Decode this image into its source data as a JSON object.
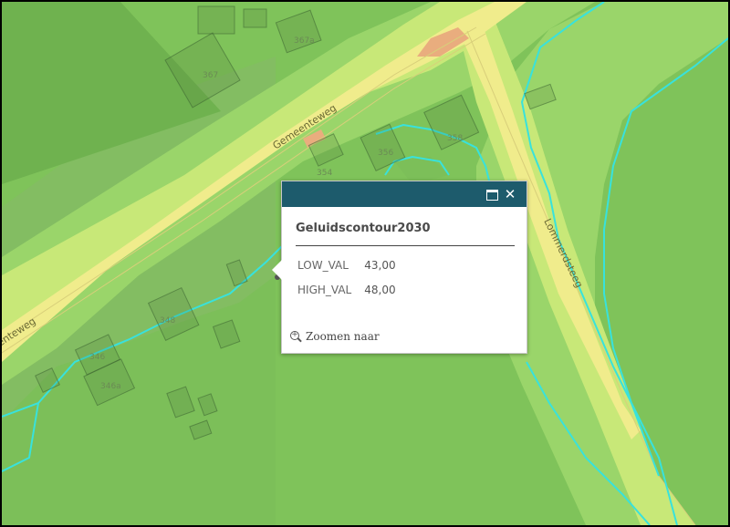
{
  "map": {
    "streets": {
      "gemeenteweg": "Gemeenteweg",
      "gemeenteweg_left": "enteweg",
      "lommerdsteeg": "Lommerdsteeg"
    },
    "house_numbers": {
      "n367a": "367a",
      "n367": "367",
      "n356": "356",
      "n358": "358",
      "n354": "354",
      "n348": "348",
      "n346": "346",
      "n346a": "346a"
    },
    "colors": {
      "low_noise": "#7fc35a",
      "mid_noise": "#a3da6b",
      "high_noise": "#d3ec7a",
      "road_noise": "#f0ec8c",
      "contour_line": "#38e2dc",
      "hot_spot": "#e9ad7e"
    }
  },
  "popup": {
    "title": "Geluidscontour2030",
    "attributes": [
      {
        "key": "LOW_VAL",
        "value": "43,00"
      },
      {
        "key": "HIGH_VAL",
        "value": "48,00"
      }
    ],
    "zoom_label": "Zoomen naar",
    "header_color": "#1d5b6c",
    "maximize_icon": "maximize-icon",
    "close_icon": "close-icon",
    "close_glyph": "✕"
  }
}
